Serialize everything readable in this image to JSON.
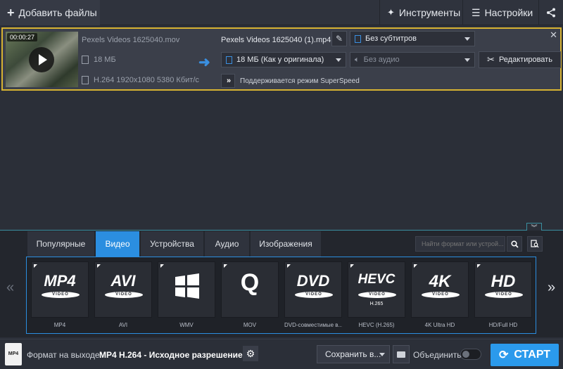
{
  "toolbar": {
    "add_files": "Добавить файлы",
    "tools": "Инструменты",
    "settings": "Настройки"
  },
  "file": {
    "duration": "00:00:27",
    "source_name": "Pexels Videos 1625040.mov",
    "source_size": "18 МБ",
    "source_codec": "H.264 1920x1080 5380 Кбит/с",
    "output_name": "Pexels Videos 1625040 (1).mp4",
    "output_size": "18 МБ (Как у оригинала)",
    "subtitles": "Без субтитров",
    "audio": "Без аудио",
    "superspeed": "Поддерживается режим SuperSpeed",
    "edit_label": "Редактировать"
  },
  "formats": {
    "tabs": [
      "Популярные",
      "Видео",
      "Устройства",
      "Аудио",
      "Изображения"
    ],
    "active_tab": "Видео",
    "search_placeholder": "Найти формат или устрой...",
    "tiles": [
      {
        "logo": "MP4",
        "badge": "VIDEO",
        "sub": "",
        "label": "MP4"
      },
      {
        "logo": "AVI",
        "badge": "VIDEO",
        "sub": "",
        "label": "AVI"
      },
      {
        "logo": "",
        "badge": "",
        "sub": "",
        "label": "WMV"
      },
      {
        "logo": "Q",
        "badge": "",
        "sub": "",
        "label": "MOV"
      },
      {
        "logo": "DVD",
        "badge": "VIDEO",
        "sub": "",
        "label": "DVD-совместимые в..."
      },
      {
        "logo": "HEVC",
        "badge": "VIDEO",
        "sub": "H.265",
        "label": "HEVC (H.265)"
      },
      {
        "logo": "4K",
        "badge": "VIDEO",
        "sub": "",
        "label": "4K Ultra HD"
      },
      {
        "logo": "HD",
        "badge": "VIDEO",
        "sub": "",
        "label": "HD/Full HD"
      }
    ]
  },
  "bottom": {
    "file_icon_text": "MP4",
    "output_label": "Формат на выходе:",
    "output_value": "MP4 H.264 - Исходное разрешение",
    "save_label": "Сохранить в...",
    "merge_label": "Объединить:",
    "start_label": "СТАРТ"
  },
  "colors": {
    "accent": "#2b8ee0",
    "card_border": "#d7b332"
  },
  "icons": {
    "add": "plus-icon",
    "tools": "magic-wand-icon",
    "settings": "hamburger-menu-icon",
    "share": "share-icon"
  }
}
